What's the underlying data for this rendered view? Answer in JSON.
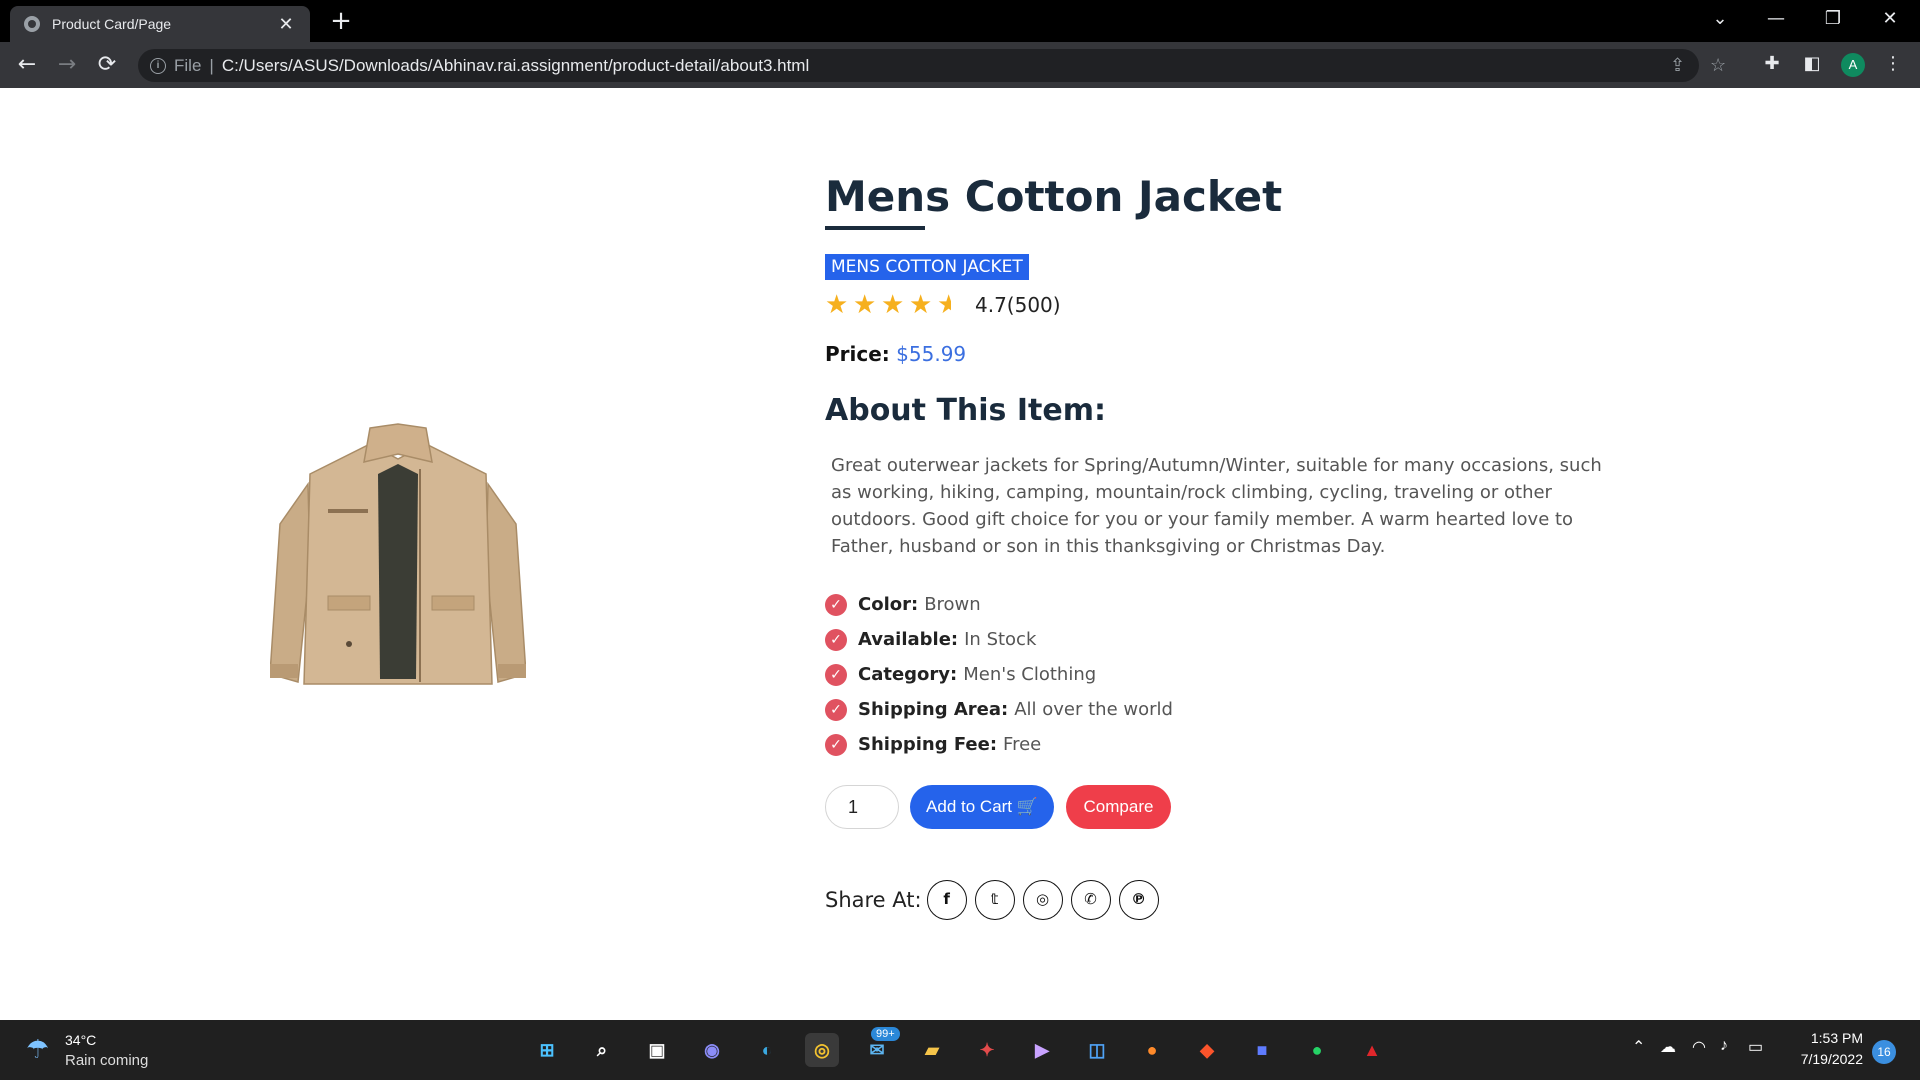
{
  "browser": {
    "tab_title": "Product Card/Page",
    "tab_close": "✕",
    "new_tab": "+",
    "scheme": "File",
    "url": "C:/Users/ASUS/Downloads/Abhinav.rai.assignment/product-detail/about3.html",
    "profile_initial": "A",
    "nav": {
      "back": "←",
      "forward": "→",
      "reload": "⟳"
    },
    "window_controls": {
      "tab_search": "⌄",
      "minimize": "—",
      "restore": "❐",
      "close": "✕"
    }
  },
  "product": {
    "title": "Mens Cotton Jacket",
    "badge": "MENS COTTON JACKET",
    "rating": "4.7(500)",
    "stars": 4.5,
    "price_label": "Price:",
    "price": "$55.99",
    "about_title": "About This Item:",
    "description": "Great outerwear jackets for Spring/Autumn/Winter, suitable for many occasions, such as working, hiking, camping, mountain/rock climbing, cycling, traveling or other outdoors. Good gift choice for you or your family member. A warm hearted love to Father, husband or son in this thanksgiving or Christmas Day.",
    "specs": [
      {
        "label": "Color:",
        "value": "Brown"
      },
      {
        "label": "Available:",
        "value": "In Stock"
      },
      {
        "label": "Category:",
        "value": "Men's Clothing"
      },
      {
        "label": "Shipping Area:",
        "value": "All over the world"
      },
      {
        "label": "Shipping Fee:",
        "value": "Free"
      }
    ],
    "quantity": "1",
    "add_to_cart": "Add to Cart",
    "compare": "Compare",
    "share_label": "Share At:",
    "social": [
      "facebook-icon",
      "twitter-icon",
      "instagram-icon",
      "whatsapp-icon",
      "pinterest-icon"
    ]
  },
  "taskbar": {
    "temperature": "34°C",
    "weather": "Rain coming",
    "mail_badge": "99+",
    "time": "1:53 PM",
    "date": "7/19/2022",
    "notifications": "16"
  },
  "colors": {
    "accent_blue": "#2563eb",
    "compare_red": "#ef3e4a",
    "star_yellow": "#f6b01e",
    "check_red": "#e05260",
    "title_navy": "#1a2b3c"
  }
}
